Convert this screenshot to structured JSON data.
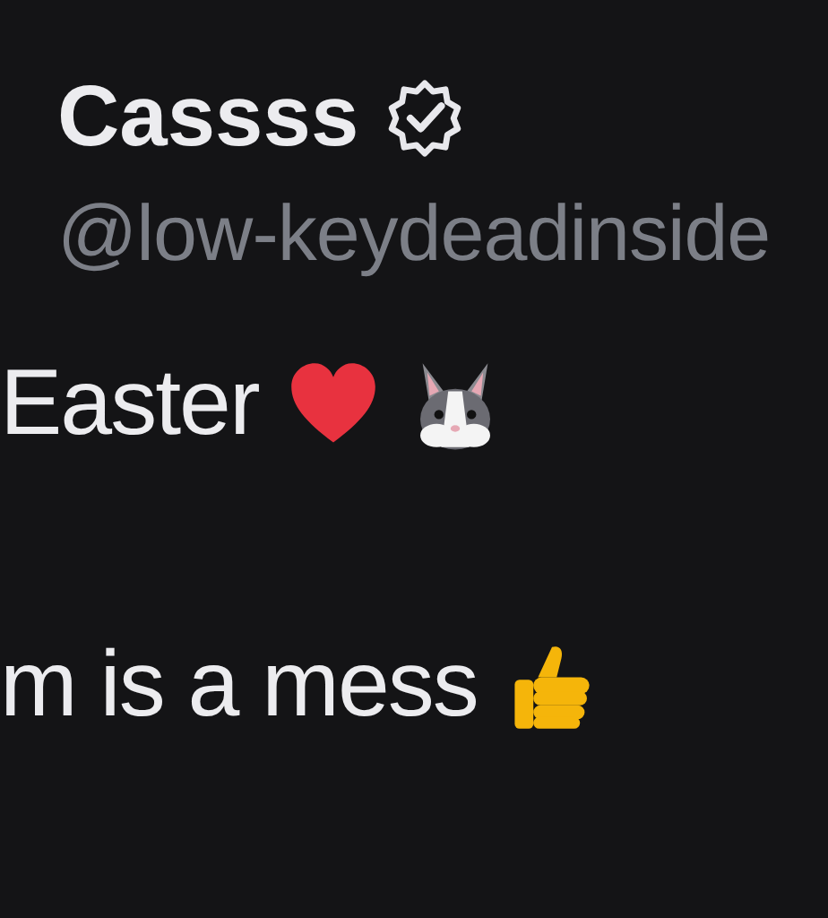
{
  "author": {
    "name": "Cassss",
    "verified": true,
    "handle": "@low-keydeadinside"
  },
  "lines": [
    {
      "text": "Easter",
      "emoji": [
        {
          "kind": "heart"
        },
        {
          "kind": "rabbit"
        }
      ]
    },
    {
      "text": "m is a mess",
      "emoji": [
        {
          "kind": "thumbs-up"
        }
      ]
    }
  ]
}
